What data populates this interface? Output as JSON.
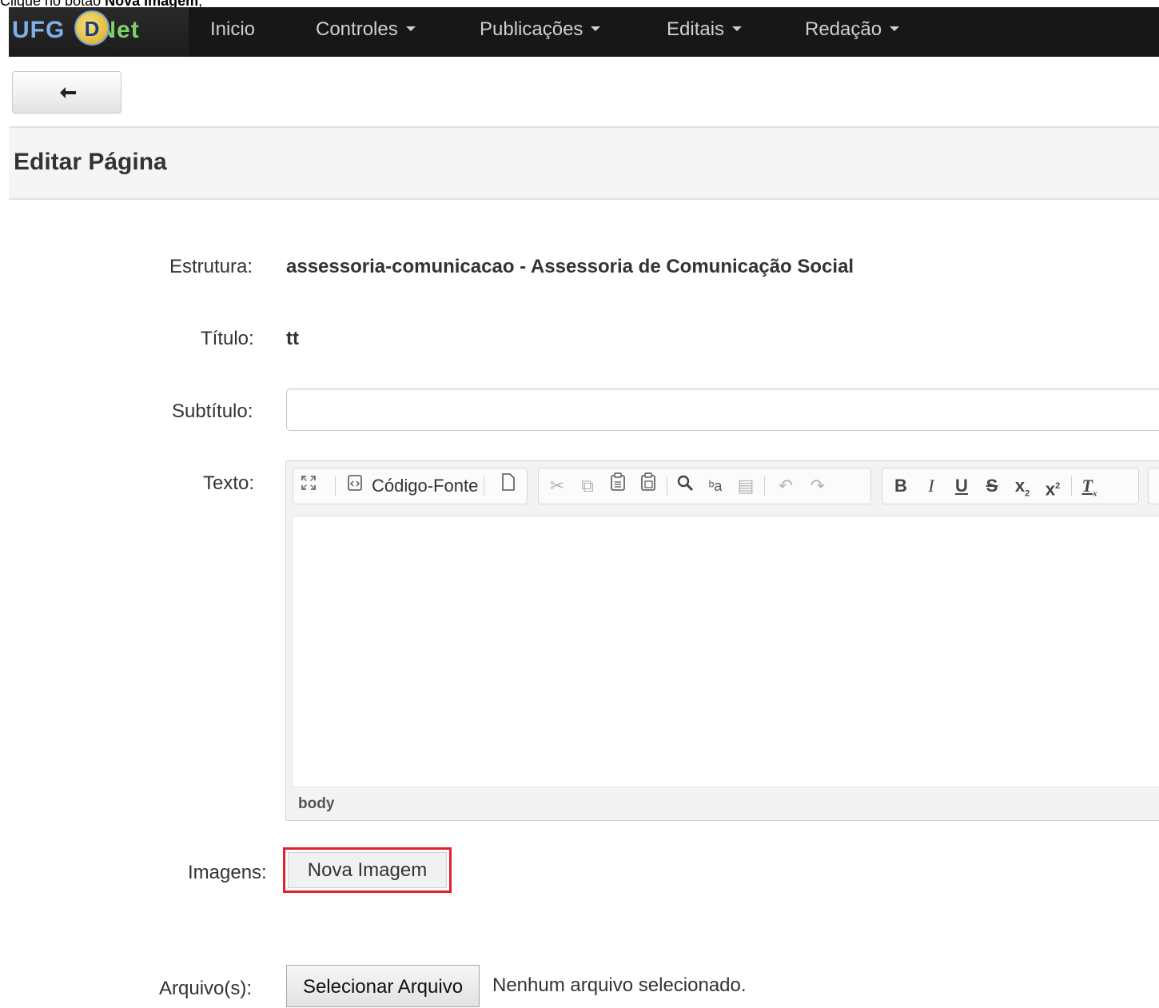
{
  "caption": {
    "prefix": "Clique no botão",
    "bold": "Nova Imagem",
    "suffix": ";"
  },
  "navbar": {
    "brand": {
      "uf": "UF",
      "g": "G",
      "d": "D",
      "net": "Net"
    },
    "items": [
      {
        "label": "Inicio",
        "dropdown": false
      },
      {
        "label": "Controles",
        "dropdown": true
      },
      {
        "label": "Publicações",
        "dropdown": true
      },
      {
        "label": "Editais",
        "dropdown": true
      },
      {
        "label": "Redação",
        "dropdown": true
      }
    ],
    "background": "#171717"
  },
  "back_button": {
    "icon": "arrow-left-icon"
  },
  "page_title": "Editar Página",
  "form": {
    "estrutura": {
      "label": "Estrutura:",
      "value": "assessoria-comunicacao - Assessoria de Comunicação Social"
    },
    "titulo": {
      "label": "Título:",
      "value": "tt"
    },
    "subtitulo": {
      "label": "Subtítulo:",
      "value": "",
      "placeholder": ""
    },
    "texto": {
      "label": "Texto:",
      "toolbar": {
        "source_label": "Código-Fonte",
        "icons": [
          "maximize-icon",
          "source-icon",
          "new-page-icon",
          "cut-icon",
          "copy-icon",
          "paste-icon",
          "paste-word-icon",
          "find-icon",
          "replace-icon",
          "select-all-icon",
          "undo-icon",
          "redo-icon",
          "bold-icon",
          "italic-icon",
          "underline-icon",
          "strike-icon",
          "subscript-icon",
          "superscript-icon",
          "remove-format-icon"
        ]
      },
      "status_path": "body"
    },
    "imagens": {
      "label": "Imagens:",
      "button": "Nova Imagem",
      "highlight_color": "#e0202d"
    },
    "arquivos": {
      "label": "Arquivo(s):",
      "button": "Selecionar Arquivo",
      "status": "Nenhum arquivo selecionado."
    }
  }
}
